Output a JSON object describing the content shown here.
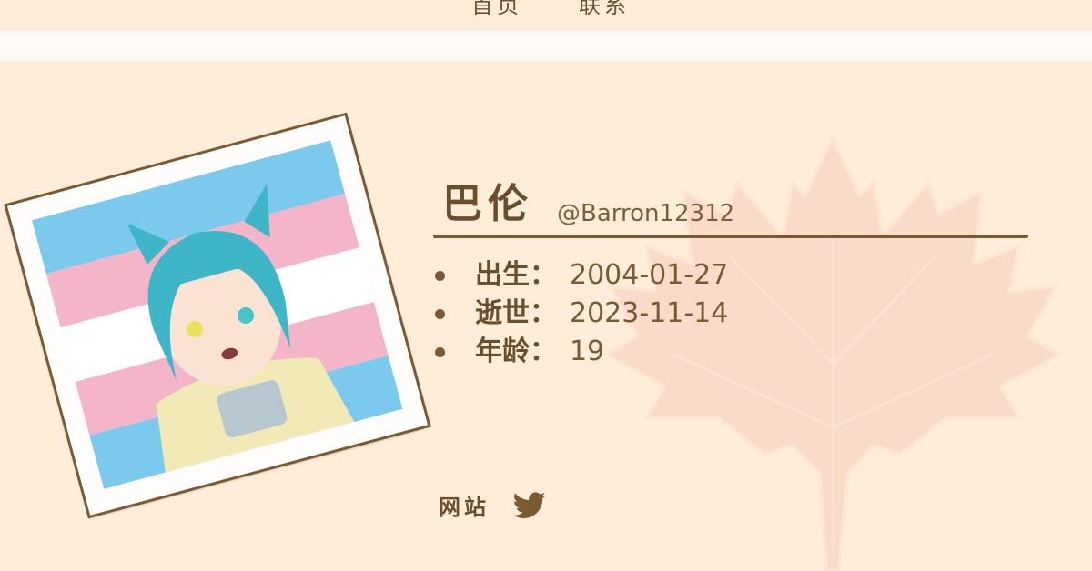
{
  "nav": {
    "home": "首页",
    "contact": "联系"
  },
  "profile": {
    "name": "巴伦",
    "handle": "@Barron12312",
    "facts": [
      {
        "label": "出生：",
        "value": "2004-01-27"
      },
      {
        "label": "逝世：",
        "value": "2023-11-14"
      },
      {
        "label": "年龄：",
        "value": "19"
      }
    ]
  },
  "links": {
    "website": "网站",
    "twitter_icon": "twitter-bird-icon"
  },
  "colors": {
    "background": "#feedd9",
    "band": "#fffaf6",
    "brown": "#7a5a33",
    "leaf": "#f7cdbd",
    "flag_blue": "#7cc9ee",
    "flag_pink": "#f5b5c8",
    "flag_white": "#ffffff",
    "hair": "#3fb6c8"
  }
}
